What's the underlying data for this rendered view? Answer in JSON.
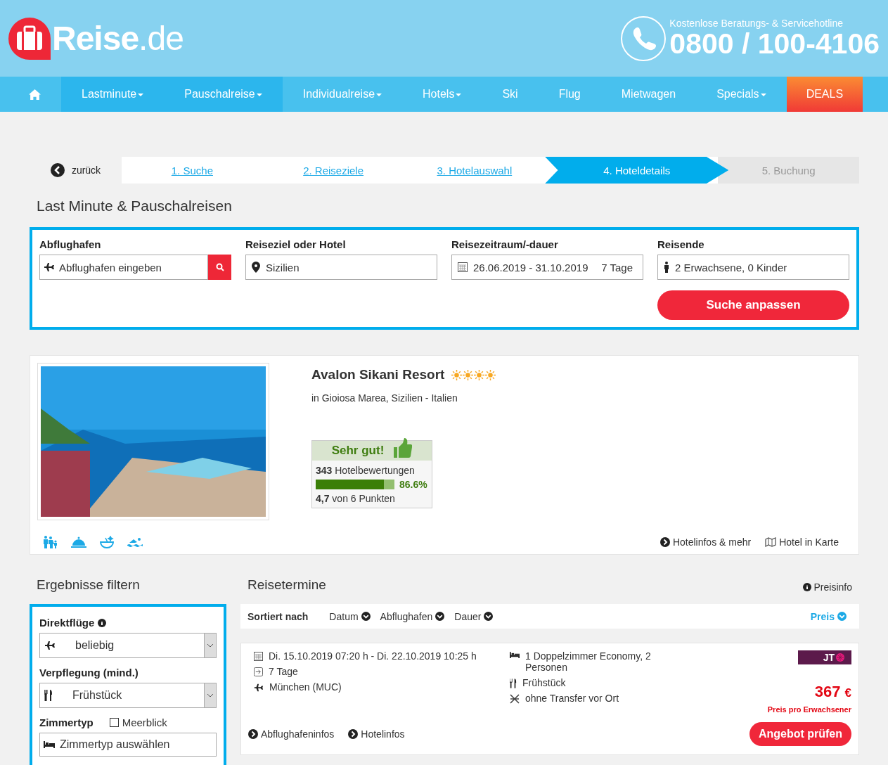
{
  "header": {
    "logo": "**Reise**.de",
    "hotline_label": "Kostenlose Beratungs- & Servicehotline",
    "hotline_number": "0800 / 100-4106"
  },
  "nav": {
    "items": [
      {
        "kind": "home",
        "selected": false,
        "dropdown": false
      },
      {
        "kind": "link",
        "label": "Lastminute",
        "selected": true,
        "dropdown": true
      },
      {
        "kind": "link",
        "label": "Pauschalreise",
        "selected": true,
        "dropdown": true
      },
      {
        "kind": "link",
        "label": "Individualreise",
        "selected": false,
        "dropdown": true
      },
      {
        "kind": "link",
        "label": "Hotels",
        "selected": false,
        "dropdown": true
      },
      {
        "kind": "link",
        "label": "Ski",
        "selected": false,
        "dropdown": false
      },
      {
        "kind": "link",
        "label": "Flug",
        "selected": false,
        "dropdown": false
      },
      {
        "kind": "link",
        "label": "Mietwagen",
        "selected": false,
        "dropdown": false
      },
      {
        "kind": "link",
        "label": "Specials",
        "selected": false,
        "dropdown": true
      },
      {
        "kind": "deals",
        "label": "DEALS",
        "selected": false,
        "dropdown": false
      }
    ]
  },
  "steps": {
    "back": "zurück",
    "items": [
      {
        "label": "1. Suche",
        "kind": "done"
      },
      {
        "label": "2. Reiseziele",
        "kind": "done"
      },
      {
        "label": "3. Hotelauswahl",
        "kind": "done"
      },
      {
        "label": "4. Hoteldetails",
        "kind": "current"
      },
      {
        "label": "5. Buchung",
        "kind": "upcoming"
      }
    ]
  },
  "search": {
    "title": "Last Minute & Pauschalreisen",
    "fields": [
      {
        "label": "Abflughafen",
        "kind": "airport",
        "placeholder": "Abflughafen eingeben"
      },
      {
        "label": "Reiseziel oder Hotel",
        "kind": "destination",
        "value": "Sizilien"
      },
      {
        "label": "Reisezeitraum/-dauer",
        "kind": "dates",
        "value": "26.06.2019 - 31.10.2019",
        "extra": "7 Tage"
      },
      {
        "label": "Reisende",
        "kind": "travellers",
        "value": "2 Erwachsene, 0 Kinder"
      }
    ],
    "button": "Suche anpassen"
  },
  "hotel": {
    "name": "Avalon Sikani Resort",
    "stars": 4,
    "location": "in Gioiosa Marea, Sizilien - Italien",
    "rating": {
      "title": "Sehr gut!",
      "reviews": "**343** Hotelbewertungen",
      "level": 0.866,
      "percent": "86.6%",
      "score": "**4,7** von 6 Punkten"
    },
    "links": [
      "Hotelinfos & mehr",
      "Hotel in Karte"
    ]
  },
  "filter": {
    "title": "Ergebnisse filtern",
    "direct_label": "Direktflüge",
    "direct_value": "beliebig",
    "board_label": "Verpflegung (mind.)",
    "board_value": "Frühstück",
    "room_label": "Zimmertyp",
    "sea_view": {
      "label": "Meerblick",
      "checked": false
    },
    "room_placeholder": "Zimmertyp auswählen"
  },
  "dates": {
    "title": "Reisetermine",
    "price_info": "Preisinfo",
    "sort_label": "Sortiert nach",
    "sort_options": [
      {
        "label": "Datum",
        "selected": false
      },
      {
        "label": "Abflughafen",
        "selected": false
      },
      {
        "label": "Dauer",
        "selected": false
      },
      {
        "label": "Preis",
        "selected": true
      }
    ],
    "offer": {
      "period": "Di. 15.10.2019 07:20 h - Di. 22.10.2019 10:25 h",
      "duration": "7 Tage",
      "airport": "München (MUC)",
      "room": "1 Doppelzimmer Economy, 2 Personen",
      "board": "Frühstück",
      "transfer": "ohne Transfer vor Ort",
      "operator": "JT",
      "price": "367",
      "currency": "€",
      "price_note": "Preis pro Erwachsener",
      "button": "Angebot prüfen",
      "links": [
        "Abflughafeninfos",
        "Hotelinfos"
      ]
    }
  }
}
